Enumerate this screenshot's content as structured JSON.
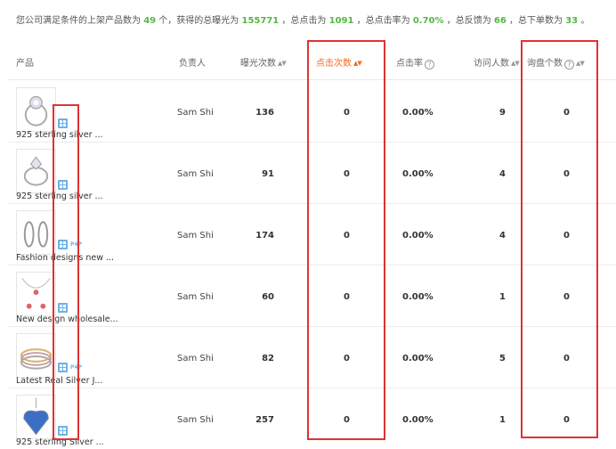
{
  "summary": {
    "p1": "您公司满足条件的上架产品数为",
    "products": "49",
    "p2": "个，获得的总曝光为",
    "exposure": "155771",
    "p3": "，总点击为",
    "clicks": "1091",
    "p4": "，总点击率为",
    "ctr": "0.70%",
    "p5": "，总反馈为",
    "feedback": "66",
    "p6": "，总下单数为",
    "orders": "33",
    "p7": "。"
  },
  "columns": {
    "product": "产品",
    "owner": "负责人",
    "exposure": "曝光次数",
    "clicks": "点击次数",
    "ctr": "点击率",
    "visitors": "访问人数",
    "inquiries": "询盘个数"
  },
  "rows": [
    {
      "name": "925 sterling silver ...",
      "owner": "Sam Shi",
      "exposure": "136",
      "clicks": "0",
      "ctr": "0.00%",
      "visitors": "9",
      "inquiries": "0",
      "pp": ""
    },
    {
      "name": "925 sterling silver ...",
      "owner": "Sam Shi",
      "exposure": "91",
      "clicks": "0",
      "ctr": "0.00%",
      "visitors": "4",
      "inquiries": "0",
      "pp": ""
    },
    {
      "name": "Fashion designs new ...",
      "owner": "Sam Shi",
      "exposure": "174",
      "clicks": "0",
      "ctr": "0.00%",
      "visitors": "4",
      "inquiries": "0",
      "pp": "P4P"
    },
    {
      "name": "New design wholesale...",
      "owner": "Sam Shi",
      "exposure": "60",
      "clicks": "0",
      "ctr": "0.00%",
      "visitors": "1",
      "inquiries": "0",
      "pp": ""
    },
    {
      "name": "Latest Real Silver J...",
      "owner": "Sam Shi",
      "exposure": "82",
      "clicks": "0",
      "ctr": "0.00%",
      "visitors": "5",
      "inquiries": "0",
      "pp": "P4P"
    },
    {
      "name": "925 sterling Silver ...",
      "owner": "Sam Shi",
      "exposure": "257",
      "clicks": "0",
      "ctr": "0.00%",
      "visitors": "1",
      "inquiries": "0",
      "pp": ""
    }
  ],
  "icons": [
    "sort-icon",
    "help-icon",
    "product-type-icon"
  ],
  "colors": {
    "highlight": "#52b93f",
    "active_sort": "#f36c21",
    "annotation": "#e03232",
    "badge": "#6fb2e6"
  }
}
